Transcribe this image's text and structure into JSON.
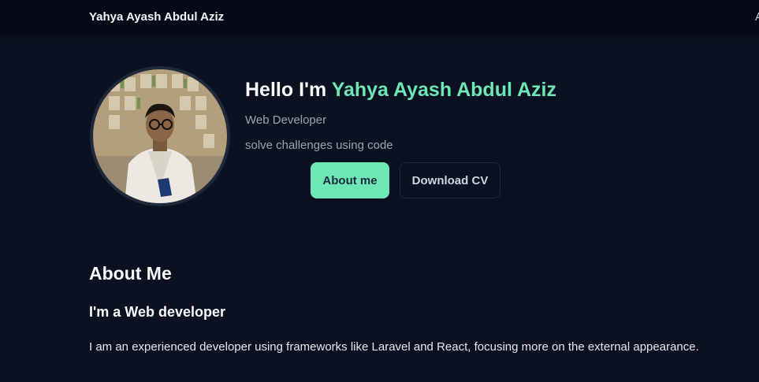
{
  "navbar": {
    "brand": "Yahya Ayash Abdul Aziz",
    "clipped_link": "A"
  },
  "hero": {
    "greeting": "Hello I'm ",
    "name": "Yahya Ayash Abdul Aziz",
    "role": "Web Developer",
    "tagline": "solve challenges using code",
    "primary_button": "About me",
    "secondary_button": "Download CV",
    "avatar_icon": "profile-photo"
  },
  "about": {
    "title": "About Me",
    "subtitle": "I'm a Web developer",
    "description": "I am an experienced developer using frameworks like Laravel and React, focusing more on the external appearance."
  },
  "colors": {
    "background": "#0b1120",
    "navbar": "#050a16",
    "accent": "#6ee7b7",
    "muted_text": "#9ca3af"
  }
}
